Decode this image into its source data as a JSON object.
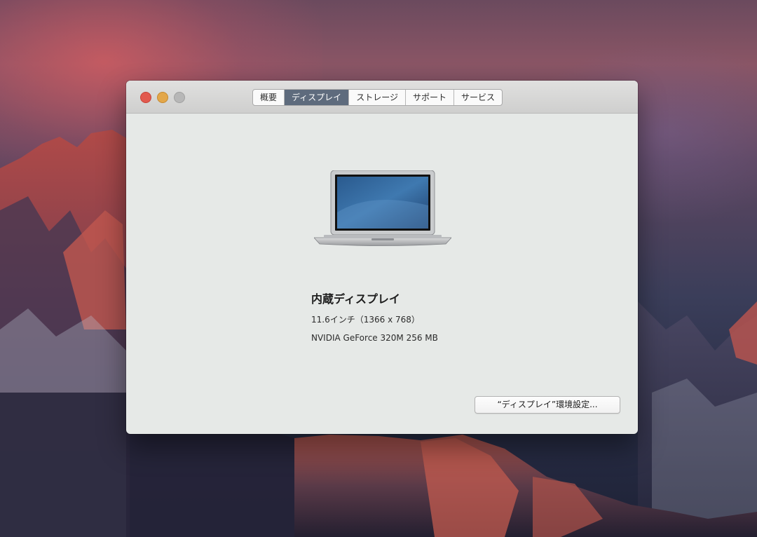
{
  "window": {
    "tabs": [
      {
        "label": "概要"
      },
      {
        "label": "ディスプレイ",
        "active": true
      },
      {
        "label": "ストレージ"
      },
      {
        "label": "サポート"
      },
      {
        "label": "サービス"
      }
    ],
    "display": {
      "name": "内蔵ディスプレイ",
      "size": "11.6インチ（1366 x 768）",
      "graphics": "NVIDIA GeForce 320M 256 MB"
    },
    "prefs_button_label": "“ディスプレイ”環境設定..."
  },
  "colors": {
    "close": "#e25a4f",
    "minimize": "#e3a74a",
    "zoom": "#b7b7b7",
    "active_tab": "#5e6b7d"
  },
  "icons": {
    "laptop": "macbook-air-icon"
  }
}
